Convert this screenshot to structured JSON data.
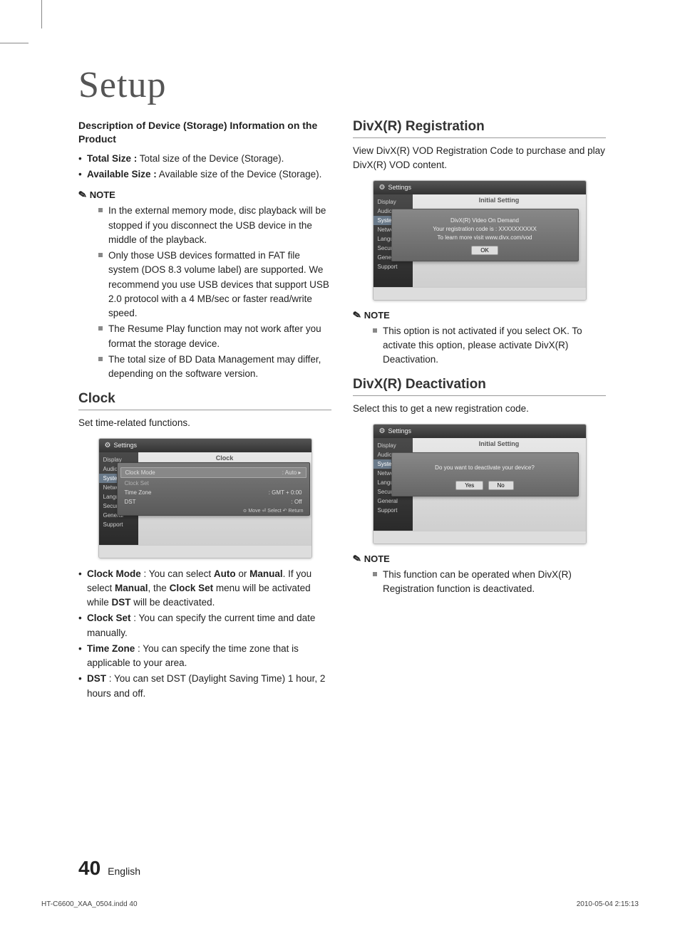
{
  "page_title": "Setup",
  "left": {
    "storage_heading": "Description of Device (Storage) Information on the Product",
    "storage_items": [
      {
        "label": "Total Size :",
        "desc": " Total size of the Device (Storage)."
      },
      {
        "label": "Available Size :",
        "desc": " Available size of the Device (Storage)."
      }
    ],
    "note_label": "NOTE",
    "storage_notes": [
      "In the external memory mode, disc playback will be stopped if you disconnect the USB device in the middle of the playback.",
      "Only those USB  devices formatted in FAT file system (DOS 8.3 volume label) are supported. We recommend you use USB devices that support USB 2.0 protocol with a 4 MB/sec or faster read/write speed.",
      "The Resume Play function may not work after you format the storage device.",
      "The total size of BD Data Management may differ, depending on the software version."
    ],
    "clock_heading": "Clock",
    "clock_intro": "Set time-related functions.",
    "clock_items": [
      {
        "html": "<b>Clock Mode</b> : You can select <b>Auto</b> or <b>Manual</b>. If you select <b>Manual</b>, the <b>Clock Set</b> menu will be activated while <b>DST</b> will be deactivated."
      },
      {
        "html": "<b>Clock Set</b> : You can specify the current time and date manually."
      },
      {
        "html": "<b>Time Zone</b> : You can specify the time zone that is applicable to your area."
      },
      {
        "html": "<b>DST</b> : You can set DST (Daylight Saving Time) 1 hour, 2 hours and off."
      }
    ]
  },
  "right": {
    "divx_reg_heading": "DivX(R) Registration",
    "divx_reg_intro": "View DivX(R) VOD Registration Code to purchase and play DivX(R) VOD content.",
    "note_label": "NOTE",
    "divx_reg_note": "This option is not activated if you select OK. To activate this option, please activate DivX(R) Deactivation.",
    "divx_deact_heading": "DivX(R) Deactivation",
    "divx_deact_intro": "Select this to get a new registration code.",
    "divx_deact_note": "This function can be operated when DivX(R) Registration function is deactivated."
  },
  "settings_ui": {
    "title": "Settings",
    "sidebar": [
      "Display",
      "Audio",
      "System",
      "Network",
      "Language",
      "Security",
      "General",
      "Support"
    ],
    "initial_setting": "Initial Setting",
    "clock_panel_title": "Clock",
    "clock_rows": {
      "mode_label": "Clock Mode",
      "mode_val": ": Auto",
      "set_label": "Clock Set",
      "tz_label": "Time Zone",
      "tz_val": ": GMT + 0:00",
      "dst_label": "DST",
      "dst_val": ": Off"
    },
    "clock_footer": "≎ Move    ⏎ Select    ↶ Return",
    "divx_reg_popup": {
      "l1": "DivX(R) Video On Demand",
      "l2": "Your registration code is : XXXXXXXXXX",
      "l3": "To learn more visit www.divx.com/vod",
      "ok": "OK"
    },
    "divx_deact_popup": {
      "q": "Do you want to deactivate your device?",
      "yes": "Yes",
      "no": "No"
    }
  },
  "footer": {
    "page": "40",
    "lang": "English",
    "doc": "HT-C6600_XAA_0504.indd   40",
    "timestamp": "2010-05-04    2:15:13"
  }
}
